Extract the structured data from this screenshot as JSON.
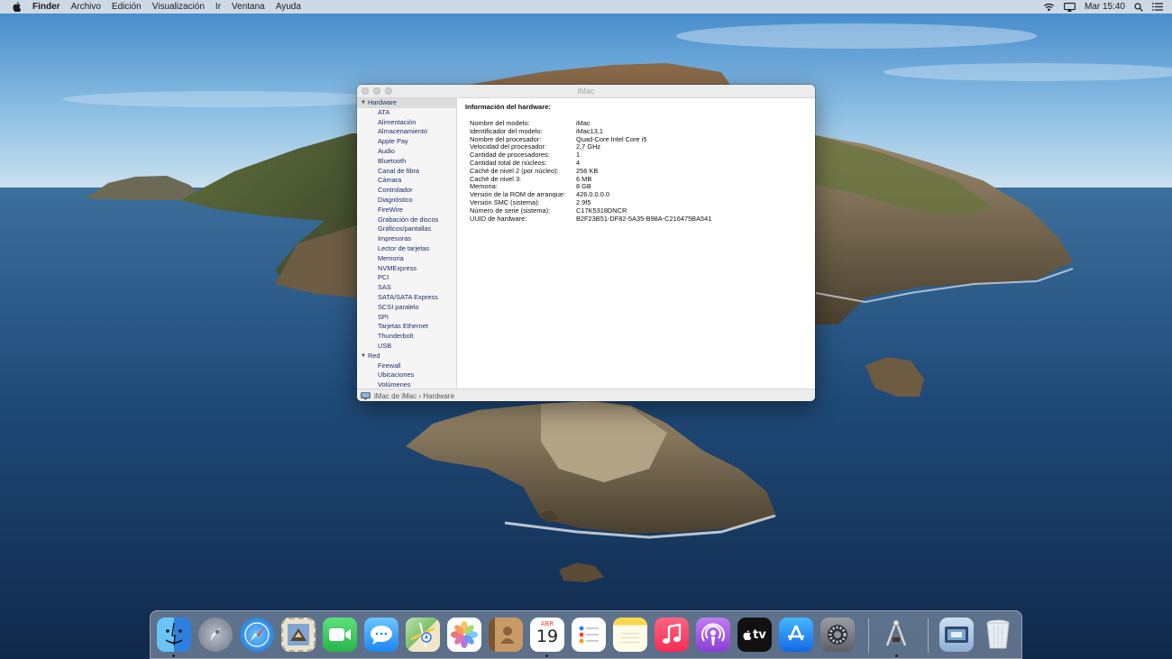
{
  "menubar": {
    "apple_icon": "apple-icon",
    "items": [
      "Finder",
      "Archivo",
      "Edición",
      "Visualización",
      "Ir",
      "Ventana",
      "Ayuda"
    ],
    "clock": "Mar 15:40",
    "icons": [
      "wifi-icon",
      "airplay-icon",
      "search-icon",
      "control-center-icon"
    ]
  },
  "window": {
    "title": "iMac",
    "sidebar": {
      "section_hardware": "Hardware",
      "hardware_items": [
        "ATA",
        "Alimentación",
        "Almacenamiento",
        "Apple Pay",
        "Audio",
        "Bluetooth",
        "Canal de fibra",
        "Cámara",
        "Controlador",
        "Diagnóstico",
        "FireWire",
        "Grabación de discos",
        "Gráficos/pantallas",
        "Impresoras",
        "Lector de tarjetas",
        "Memoria",
        "NVMExpress",
        "PCI",
        "SAS",
        "SATA/SATA Express",
        "SCSI paralelo",
        "SPI",
        "Tarjetas Ethernet",
        "Thunderbolt",
        "USB"
      ],
      "section_red": "Red",
      "red_items": [
        "Firewall",
        "Ubicaciones",
        "Volúmenes"
      ]
    },
    "content": {
      "heading": "Información del hardware:",
      "rows": [
        {
          "key": "Nombre del modelo:",
          "value": "iMac"
        },
        {
          "key": "Identificador del modelo:",
          "value": "iMac13,1"
        },
        {
          "key": "Nombre del procesador:",
          "value": "Quad-Core Intel Core i5"
        },
        {
          "key": "Velocidad del procesador:",
          "value": "2,7 GHz"
        },
        {
          "key": "Cantidad de procesadores:",
          "value": "1"
        },
        {
          "key": "Cantidad total de núcleos:",
          "value": "4"
        },
        {
          "key": "Caché de nivel 2 (por núcleo):",
          "value": "256 KB"
        },
        {
          "key": "Caché de nivel 3:",
          "value": "6 MB"
        },
        {
          "key": "Memoria:",
          "value": "8 GB"
        },
        {
          "key": "Versión de la ROM de arranque:",
          "value": "426.0.0.0.0"
        },
        {
          "key": "Versión SMC (sistema):",
          "value": "2.9f5"
        },
        {
          "key": "Número de serie (sistema):",
          "value": "C17K5318DNCR"
        },
        {
          "key": "UUID de hardware:",
          "value": "B2F23B51-DF82-5A35-B98A-C216475BA541"
        }
      ]
    },
    "statusbar": {
      "icon": "computer-icon",
      "path": "iMac de iMac › Hardware"
    }
  },
  "dock": {
    "apps": [
      {
        "name": "finder-icon",
        "color": "#3b8fe8"
      },
      {
        "name": "launchpad-icon",
        "color": "#8a929e"
      },
      {
        "name": "safari-icon",
        "color": "#1c86ee"
      },
      {
        "name": "mail-stamp-icon",
        "color": "#5b7fa8"
      },
      {
        "name": "facetime-icon",
        "color": "#34c759"
      },
      {
        "name": "messages-icon",
        "color": "#2f9bf5"
      },
      {
        "name": "maps-icon",
        "color": "#7ac06b"
      },
      {
        "name": "photos-icon",
        "color": "#ffffff"
      },
      {
        "name": "contacts-icon",
        "color": "#b88b5a"
      },
      {
        "name": "calendar-icon",
        "color": "#ffffff",
        "month": "ABR",
        "day": "19"
      },
      {
        "name": "reminders-icon",
        "color": "#ffffff"
      },
      {
        "name": "notes-icon",
        "color": "#fbe07a"
      },
      {
        "name": "music-icon",
        "color": "#fa3c5a"
      },
      {
        "name": "podcasts-icon",
        "color": "#9b4de0"
      },
      {
        "name": "apple-tv-icon",
        "color": "#111111",
        "label": "tv"
      },
      {
        "name": "app-store-icon",
        "color": "#1a8df5"
      },
      {
        "name": "system-preferences-icon",
        "color": "#7f8287"
      },
      {
        "name": "system-information-icon",
        "color": "#d8d8d8"
      },
      {
        "name": "downloads-folder-icon",
        "color": "#9bb8d8"
      },
      {
        "name": "trash-icon",
        "color": "#e8edf2"
      }
    ]
  }
}
